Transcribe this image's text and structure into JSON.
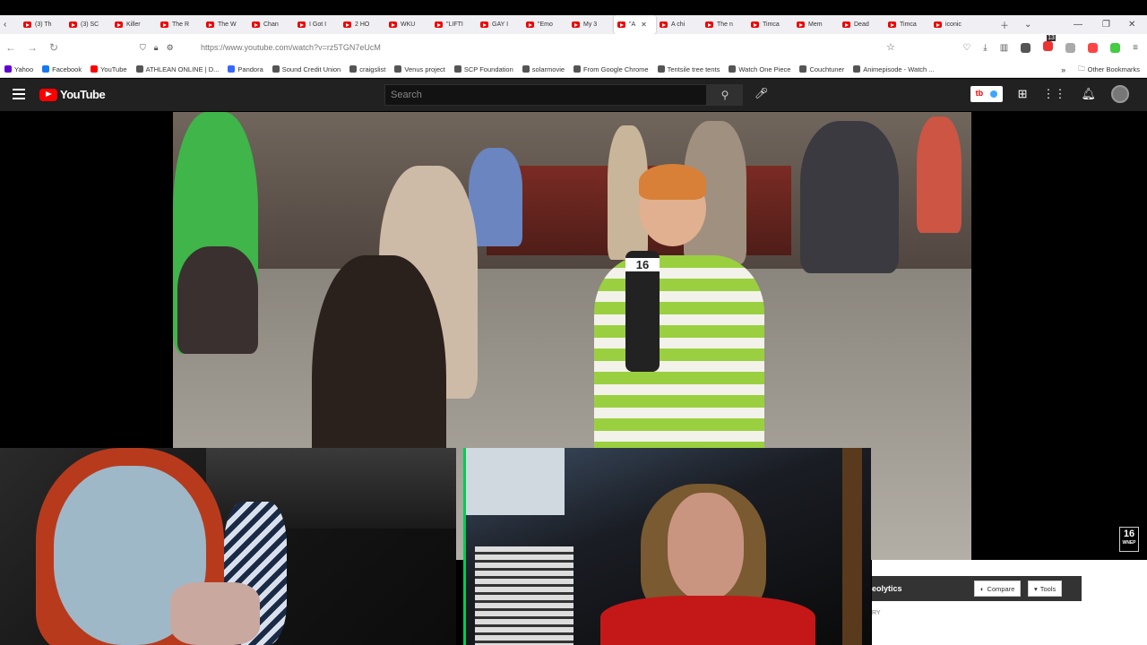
{
  "tabs": [
    {
      "label": "(3) Th",
      "active": false
    },
    {
      "label": "(3) SC",
      "active": false
    },
    {
      "label": "Killer",
      "active": false
    },
    {
      "label": "The R",
      "active": false
    },
    {
      "label": "The W",
      "active": false
    },
    {
      "label": "Chan",
      "active": false
    },
    {
      "label": "I Got I",
      "active": false
    },
    {
      "label": "2 HO",
      "active": false
    },
    {
      "label": "WKU",
      "active": false
    },
    {
      "label": "\"LIFTI",
      "active": false
    },
    {
      "label": "GAY I",
      "active": false
    },
    {
      "label": "\"Emo",
      "active": false
    },
    {
      "label": "My 3",
      "active": false
    },
    {
      "label": "\"A",
      "active": true
    },
    {
      "label": "A chi",
      "active": false
    },
    {
      "label": "The n",
      "active": false
    },
    {
      "label": "Timca",
      "active": false
    },
    {
      "label": "Mem",
      "active": false
    },
    {
      "label": "Dead",
      "active": false
    },
    {
      "label": "Timca",
      "active": false
    },
    {
      "label": "iconic",
      "active": false
    }
  ],
  "address": {
    "url": "https://www.youtube.com/watch?v=rz5TGN7eUcM",
    "badge_count": "13"
  },
  "bookmarks": [
    {
      "label": "Yahoo",
      "color": "#6001d2"
    },
    {
      "label": "Facebook",
      "color": "#1877f2"
    },
    {
      "label": "YouTube",
      "color": "#ff0000"
    },
    {
      "label": "ATHLEAN ONLINE | D...",
      "color": "#555555"
    },
    {
      "label": "Pandora",
      "color": "#3668ff"
    },
    {
      "label": "Sound Credit Union",
      "color": "#555555"
    },
    {
      "label": "craigslist",
      "color": "#555555"
    },
    {
      "label": "Venus project",
      "color": "#555555"
    },
    {
      "label": "SCP Foundation",
      "color": "#555555"
    },
    {
      "label": "solarmovie",
      "color": "#555555"
    },
    {
      "label": "From Google Chrome",
      "color": "#555555"
    },
    {
      "label": "Tentsile tree tents",
      "color": "#555555"
    },
    {
      "label": "Watch One Piece",
      "color": "#555555"
    },
    {
      "label": "Couchtuner",
      "color": "#555555"
    },
    {
      "label": "Animepisode - Watch ...",
      "color": "#555555"
    }
  ],
  "bookmarks_other": "Other Bookmarks",
  "youtube": {
    "logo_text": "YouTube",
    "search_placeholder": "Search"
  },
  "video": {
    "mic_flag": "16",
    "watermark_number": "16",
    "watermark_sub": "WNEP"
  },
  "overlay": {
    "name": "eolytics",
    "compare_label": "Compare",
    "tools_label": "Tools",
    "footer_text": "RY"
  },
  "colors": {
    "yt_red": "#ff0000",
    "yt_dark": "#212121",
    "accent_green": "#00cc55"
  }
}
